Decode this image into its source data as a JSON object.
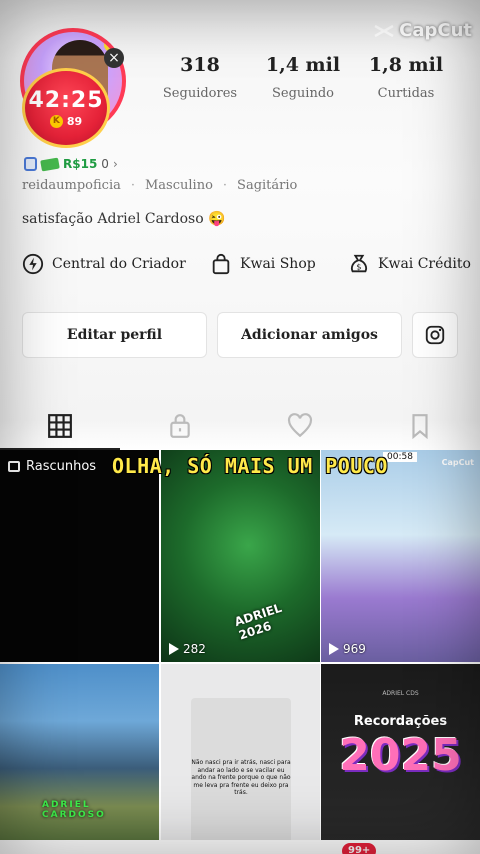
{
  "watermark": {
    "text": "CapCut"
  },
  "profile": {
    "timer": "42:25",
    "coins": "89",
    "wallet_amount": "R$15",
    "wallet_zero": "0",
    "meta": [
      "reidaumpoficia",
      "Masculino",
      "Sagitário"
    ],
    "bio": "satisfação Adriel Cardoso 😜"
  },
  "stats": [
    {
      "value": "318",
      "label": "Seguidores"
    },
    {
      "value": "1,4 mil",
      "label": "Seguindo"
    },
    {
      "value": "1,8 mil",
      "label": "Curtidas"
    }
  ],
  "shortcuts": [
    {
      "label": "Central do Criador",
      "icon": "lightning-circle-icon"
    },
    {
      "label": "Kwai Shop",
      "icon": "shopping-bag-icon"
    },
    {
      "label": "Kwai Crédito",
      "icon": "money-bag-icon"
    }
  ],
  "buttons": {
    "edit_profile": "Editar perfil",
    "add_friends": "Adicionar amigos"
  },
  "tabs": [
    "grid-icon",
    "lock-bag-icon",
    "heart-icon",
    "bookmark-icon"
  ],
  "grid": {
    "draft_label": "Rascunhos",
    "overlay_caption": "OLHA, SÓ MAIS UM POUCO",
    "video2_plays": "282",
    "video2_tag": "ADRIEL 2026",
    "video3_plays": "969",
    "video3_time": "00:58",
    "video4_caption": "ADRIEL CARDOSO",
    "video5_text": "Não nasci pra ir atrás, nasci para andar ao lado e se vacilar eu ando na frente porque o que não me leva pra frente eu deixo pra trás.",
    "video6_user": "ADRIEL CDS",
    "video6_title": "Recordações",
    "video6_year": "2025",
    "mini_capcut": "CapCut"
  },
  "bottom_nav": {
    "badge": "99+"
  },
  "colors": {
    "accent_red": "#e8213b",
    "wallet_green": "#1f9c42",
    "verify_blue": "#4c7bd9"
  }
}
